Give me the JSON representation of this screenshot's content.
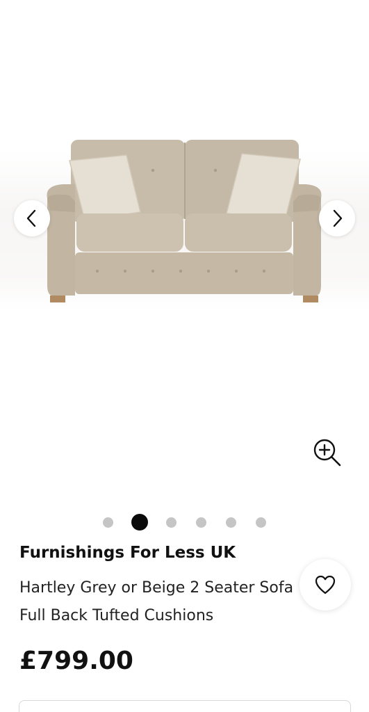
{
  "gallery": {
    "image_subject": "sofa-icon",
    "prev_icon": "chevron-left-icon",
    "next_icon": "chevron-right-icon",
    "zoom_icon": "zoom-in-icon",
    "total_images": 6,
    "active_image_index": 1
  },
  "listing": {
    "seller": "Furnishings For Less UK",
    "title": "Hartley Grey or Beige 2 Seater Sofa Full Back Tufted Cushions",
    "price": "£799.00",
    "favourite_icon": "heart-icon"
  },
  "colors": {
    "sofa_fabric": "#c9bdad",
    "cushion": "#e4ddd1",
    "active_dot": "#0a0a0a",
    "inactive_dot": "#c5c5c5"
  }
}
